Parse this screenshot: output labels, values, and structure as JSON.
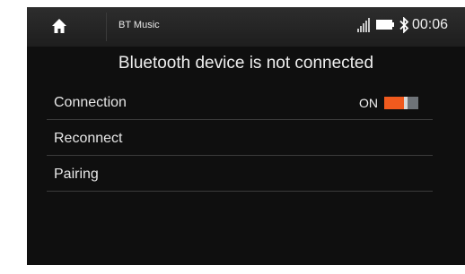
{
  "statusbar": {
    "home_icon": "home-icon",
    "app_title": "BT Music",
    "signal_icon": "signal-icon",
    "battery_icon": "battery-icon",
    "bluetooth_icon": "bluetooth-icon",
    "time": "00:06"
  },
  "message": "Bluetooth device is not connected",
  "menu": {
    "connection": {
      "label": "Connection",
      "state": "ON",
      "on": true
    },
    "reconnect": {
      "label": "Reconnect"
    },
    "pairing": {
      "label": "Pairing"
    }
  },
  "colors": {
    "accent": "#f05a1e",
    "background": "#0f0f0f",
    "statusbar": "#252525"
  }
}
